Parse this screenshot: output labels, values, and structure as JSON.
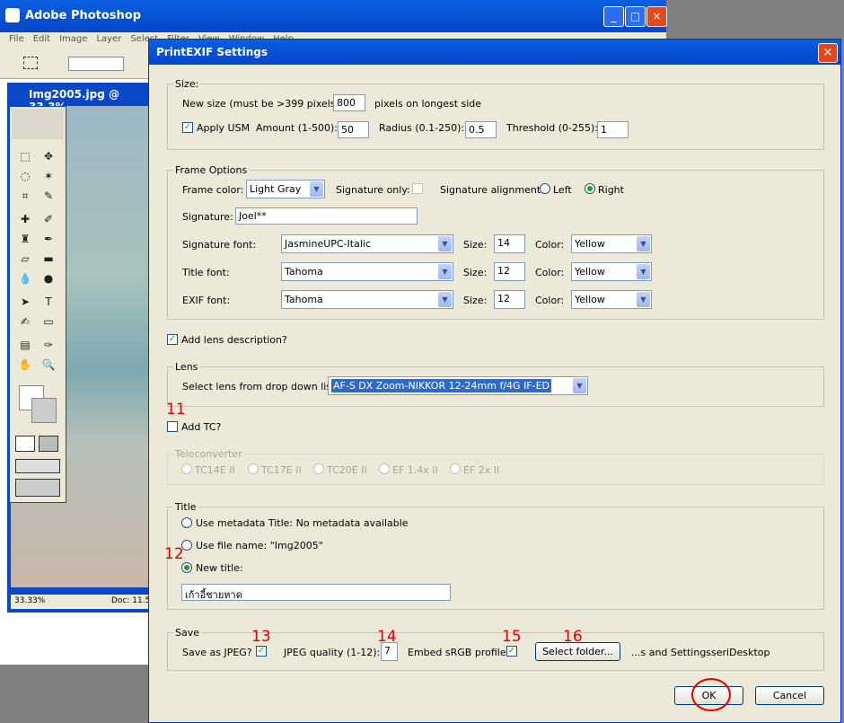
{
  "photoshop": {
    "title": "Adobe Photoshop",
    "menu": [
      "File",
      "Edit",
      "Image",
      "Layer",
      "Select",
      "Filter",
      "View",
      "Window",
      "Help"
    ],
    "document": {
      "title": "Img2005.jpg @ 33.3%",
      "zoom": "33.33%",
      "doc_info": "Doc: 11.5"
    }
  },
  "dialog": {
    "title": "PrintEXIF Settings",
    "size": {
      "legend": "Size:",
      "new_size_label": "New size (must be >399 pixels):",
      "new_size_value": "800",
      "new_size_suffix": "pixels on longest side",
      "apply_usm_label": "Apply USM",
      "amount_label": "Amount (1-500):",
      "amount_value": "50",
      "radius_label": "Radius (0.1-250):",
      "radius_value": "0.5",
      "threshold_label": "Threshold (0-255):",
      "threshold_value": "1"
    },
    "frame": {
      "legend": "Frame Options",
      "frame_color_label": "Frame color:",
      "frame_color_value": "Light Gray",
      "signature_only_label": "Signature only:",
      "alignment_label": "Signature alignment:",
      "left_label": "Left",
      "right_label": "Right",
      "signature_label": "Signature:",
      "signature_value": "Joel**",
      "sig_font_label": "Signature font:",
      "sig_font_value": "JasmineUPC-Italic",
      "title_font_label": "Title font:",
      "title_font_value": "Tahoma",
      "exif_font_label": "EXIF font:",
      "exif_font_value": "Tahoma",
      "size_label": "Size:",
      "color_label": "Color:",
      "sig_size": "14",
      "title_size": "12",
      "exif_size": "12",
      "sig_color": "Yellow",
      "title_color": "Yellow",
      "exif_color": "Yellow"
    },
    "add_lens_label": "Add lens description?",
    "lens": {
      "legend": "Lens",
      "select_label": "Select lens from drop down list:",
      "value": "AF-S DX Zoom-NIKKOR 12-24mm f/4G IF-ED"
    },
    "add_tc_label": "Add TC?",
    "teleconverter": {
      "legend": "Teleconverter",
      "options": [
        "TC14E II",
        "TC17E II",
        "TC20E II",
        "EF 1.4x II",
        "EF 2x II"
      ]
    },
    "title_section": {
      "legend": "Title",
      "metadata_label": "Use metadata Title: No metadata available",
      "filename_label": "Use file name: \"Img2005\"",
      "new_title_label": "New title:",
      "new_title_value": "เก้าอี้ชายหาด"
    },
    "save": {
      "legend": "Save",
      "jpeg_label": "Save as JPEG?",
      "quality_label": "JPEG quality (1-12):",
      "quality_value": "7",
      "srgb_label": "Embed sRGB profile?",
      "folder_button": "Select folder...",
      "folder_path": "...s and SettingsseriDesktop"
    },
    "ok_label": "OK",
    "cancel_label": "Cancel"
  },
  "annotations": {
    "a11": "11",
    "a12": "12",
    "a13": "13",
    "a14": "14",
    "a15": "15",
    "a16": "16"
  },
  "colors": {
    "annotation": "#e00000",
    "titlebar": "#0546c8"
  }
}
